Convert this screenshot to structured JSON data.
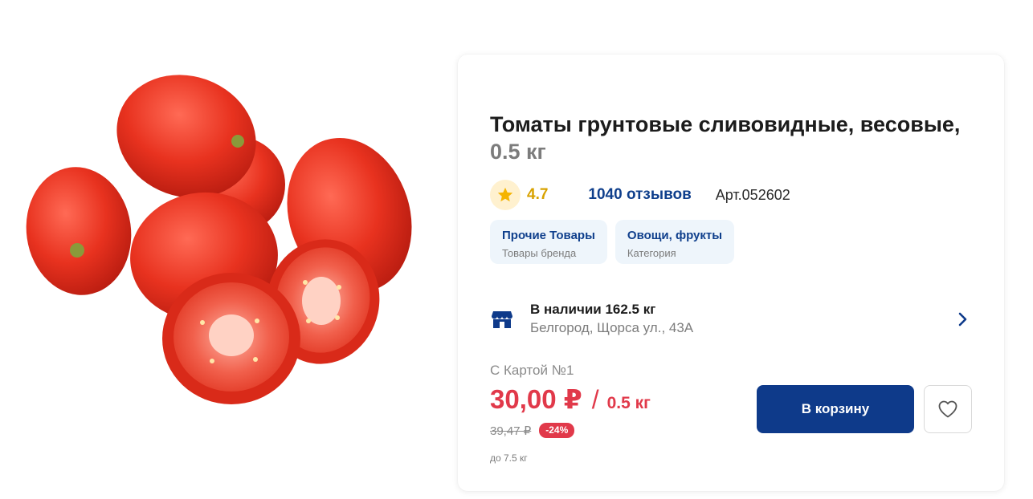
{
  "product": {
    "title": "Томаты грунтовые сливовидные, весовые,",
    "weight": "0.5 кг",
    "rating": "4.7",
    "reviews": "1040 отзывов",
    "article": "Арт.052602",
    "image_icon": "tomato-product-photo"
  },
  "chips": [
    {
      "title": "Прочие Товары",
      "subtitle": "Товары бренда"
    },
    {
      "title": "Овощи, фрукты",
      "subtitle": "Категория"
    }
  ],
  "stock": {
    "availability": "В наличии 162.5 кг",
    "address": "Белгород, Щорса ул., 43А",
    "icon": "store-icon"
  },
  "pricing": {
    "card_label": "С Картой №1",
    "price": "30,00 ₽",
    "separator": "/",
    "unit": "0.5 кг",
    "old_price": "39,47 ₽",
    "discount": "-24%",
    "limit": "до 7.5 кг"
  },
  "actions": {
    "cart_label": "В корзину",
    "favorite_icon": "heart-icon"
  },
  "colors": {
    "brand_blue": "#0e3a8a",
    "price_red": "#e1394a",
    "rating_gold": "#d8a200",
    "chip_bg": "#eef5fb"
  }
}
